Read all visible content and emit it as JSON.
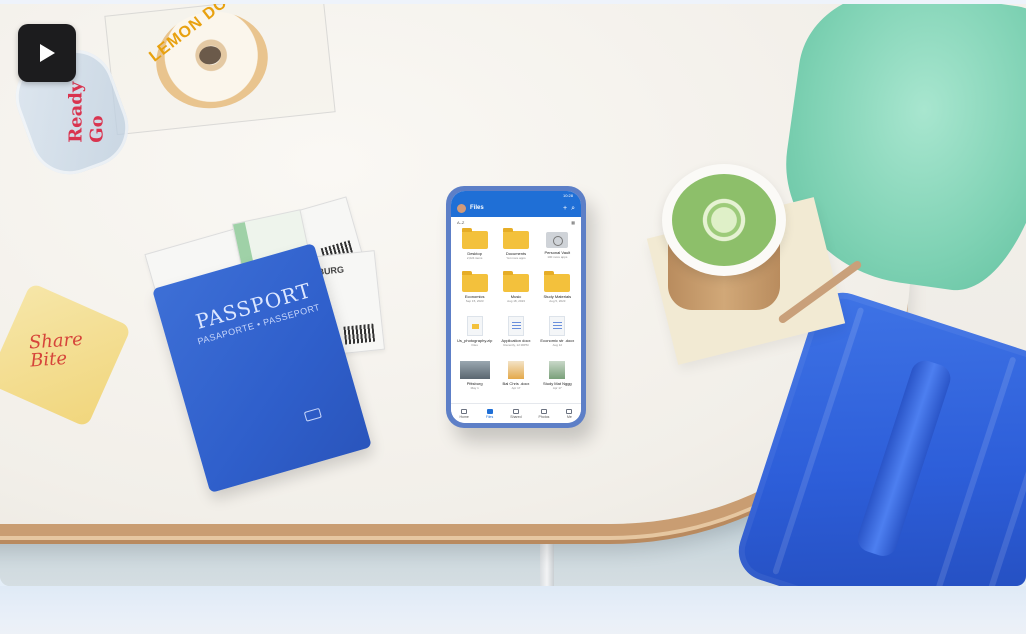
{
  "video": {
    "play_icon": "play-icon"
  },
  "scene": {
    "passport_title": "PASSPORT",
    "passport_subtitle": "PASAPORTE • PASSEPORT",
    "snack_brand": "Share Bite",
    "donut_sticker": "LEMON DONUT",
    "bottle_label": "Ready Go",
    "ticket_text": "BURG"
  },
  "phone": {
    "status_time": "10:28",
    "app_title": "Files",
    "sort_label": "A–Z",
    "items": [
      {
        "name": "Desktop",
        "meta": "2,024 items",
        "kind": "folder"
      },
      {
        "name": "Documents",
        "meta": "Yet more apps",
        "kind": "folder"
      },
      {
        "name": "Personal Vault",
        "meta": "100 more apps",
        "kind": "vault"
      },
      {
        "name": "Economics",
        "meta": "Sep 15, 2023",
        "kind": "folder"
      },
      {
        "name": "Music",
        "meta": "Aug 18, 2023",
        "kind": "folder"
      },
      {
        "name": "Study Materials",
        "meta": "Aug 5, 2023",
        "kind": "folder"
      },
      {
        "name": "Us_photography.zip",
        "meta": "Files",
        "kind": "zip"
      },
      {
        "name": "Application docx",
        "meta": "Recently, 12:30PM",
        "kind": "doc"
      },
      {
        "name": "Economic str .docx",
        "meta": "Aug 12",
        "kind": "doc"
      },
      {
        "name": "Pittsburg",
        "meta": "May 1",
        "kind": "photo"
      },
      {
        "name": "Bal Chris .docx",
        "meta": "Apr 17",
        "kind": "photo2"
      },
      {
        "name": "Study Mat Nggg",
        "meta": "Apr 17",
        "kind": "photo3"
      }
    ],
    "nav": [
      {
        "label": "Home",
        "active": false
      },
      {
        "label": "Files",
        "active": true
      },
      {
        "label": "Shared",
        "active": false
      },
      {
        "label": "Photos",
        "active": false
      },
      {
        "label": "Me",
        "active": false
      }
    ]
  },
  "colors": {
    "accent": "#1f6fd6",
    "folder": "#f3c13c",
    "passport": "#2f5fcb"
  }
}
